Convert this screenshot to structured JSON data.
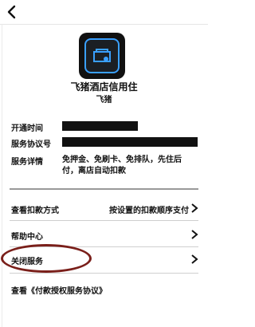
{
  "service": {
    "title": "飞猪酒店信用住",
    "provider": "飞猪"
  },
  "details": [
    {
      "label": "开通时间",
      "value": ""
    },
    {
      "label": "服务协议号",
      "value": ""
    },
    {
      "label": "服务详情",
      "value": "免押金、免刷卡、免排队，先住后付，离店自动扣款"
    }
  ],
  "menu": [
    {
      "label": "查看扣款方式",
      "value": "按设置的扣款顺序支付"
    },
    {
      "label": "帮助中心",
      "value": ""
    },
    {
      "label": "关闭服务",
      "value": ""
    }
  ],
  "footer": {
    "text": "查看《付款授权服务协议》"
  },
  "colors": {
    "annotation_oval": "#7a1f1a",
    "icon_accent": "#3aa0ff"
  },
  "icons": {
    "back": "back-chevron",
    "app": "hotel-service-icon"
  }
}
